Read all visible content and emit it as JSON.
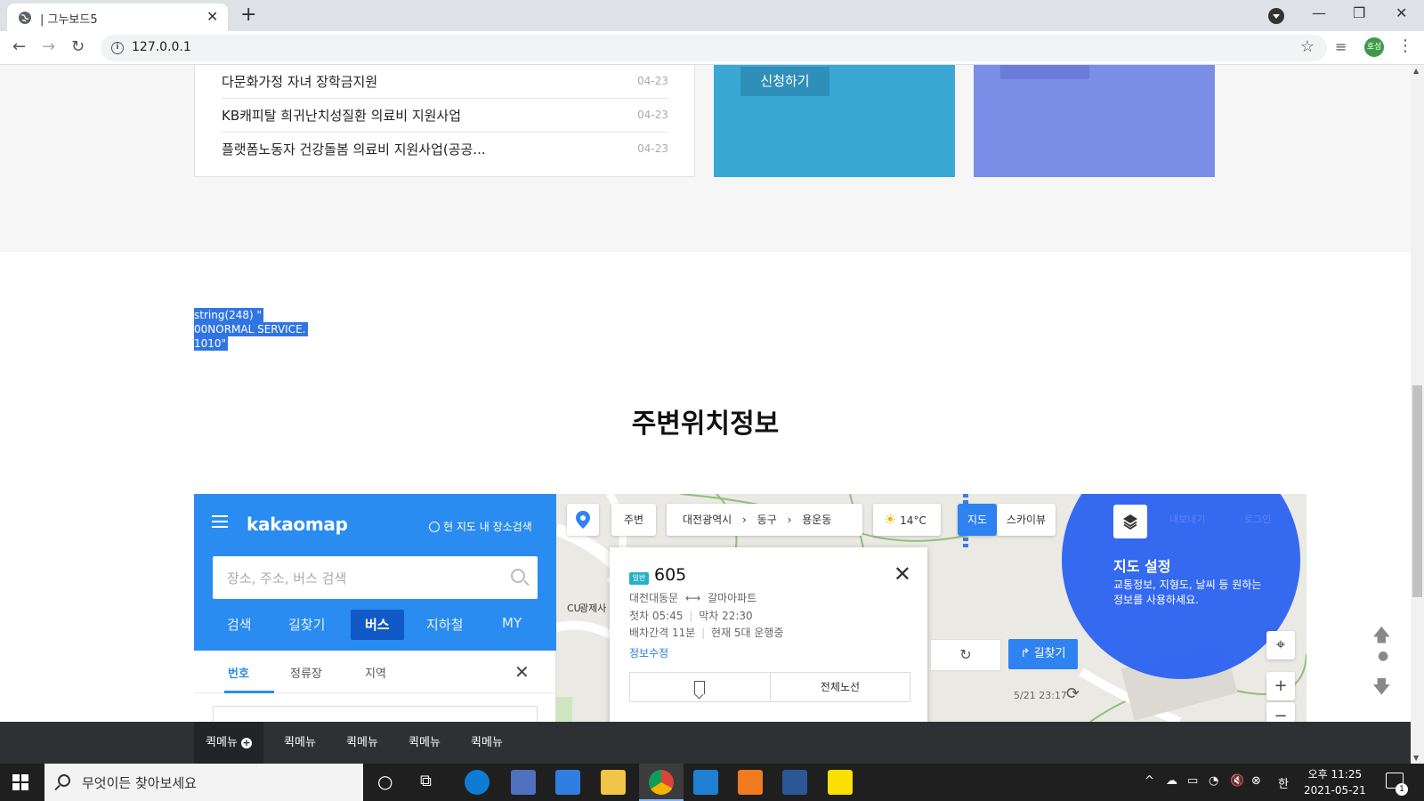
{
  "browser": {
    "tab_title": "| 그누보드5",
    "url": "127.0.0.1",
    "profile_initials": "호성"
  },
  "notices": [
    {
      "title": "다문화가정 자녀 장학금지원",
      "date": "04-23"
    },
    {
      "title": "KB캐피탈 희귀난치성질환 의료비 지원사업",
      "date": "04-23"
    },
    {
      "title": "플랫폼노동자 건강돌봄 의료비 지원사업(공공...",
      "date": "04-23"
    }
  ],
  "cards": {
    "apply_label": "신청하기"
  },
  "debug_output": {
    "line1": "string(248) \"",
    "line2": "00NORMAL SERVICE.",
    "line3": "1010\""
  },
  "section": {
    "title": "주변위치정보"
  },
  "kakao": {
    "logo": "kakaomap",
    "current_area_search": "현 지도 내 장소검색",
    "search_placeholder": "장소, 주소, 버스 검색",
    "nav": [
      "검색",
      "길찾기",
      "버스",
      "지하철",
      "MY"
    ],
    "active_nav": "버스",
    "subtabs": [
      "번호",
      "정류장",
      "지역"
    ],
    "active_subtab": "번호",
    "map_toolbar": {
      "nearby": "주변",
      "region1": "대전광역시",
      "region2": "동구",
      "region3": "용운동",
      "temperature": "14°C",
      "map_view": "지도",
      "skyview": "스카이뷰",
      "export": "내보내기",
      "login": "로그인"
    },
    "map_labels": {
      "cu": "CU",
      "gwangjesa": "광제사"
    },
    "bus": {
      "badge": "일반",
      "number": "605",
      "route_from": "대전대동문",
      "route_to": "갈마아파트",
      "first_bus": "첫차 05:45",
      "last_bus": "막차 22:30",
      "interval": "배차간격 11분",
      "running": "현재 5대 운행중",
      "edit_info": "정보수정",
      "full_route": "전체노선"
    },
    "route_button": "길찾기",
    "timestamp": "5/21 23:17",
    "settings": {
      "title": "지도 설정",
      "desc": "교통정보, 지형도, 날씨 등 원하는 정보를 사용하세요."
    }
  },
  "quick_menu": [
    "퀵메뉴",
    "퀵메뉴",
    "퀵메뉴",
    "퀵메뉴",
    "퀵메뉴"
  ],
  "taskbar": {
    "search_placeholder": "무엇이든 찾아보세요",
    "ime": "한",
    "time": "오후 11:25",
    "date": "2021-05-21",
    "notification_count": "1"
  }
}
